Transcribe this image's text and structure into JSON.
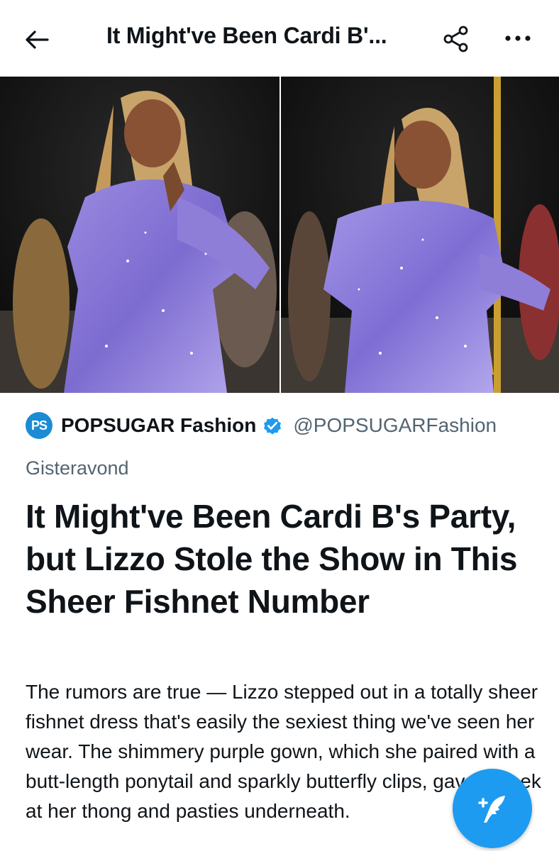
{
  "header": {
    "title": "It Might've Been Cardi B'...",
    "back_icon": "arrow-left-icon",
    "share_icon": "share-icon",
    "more_icon": "more-horizontal-icon"
  },
  "media": {
    "description_icons": [
      "photo-left",
      "photo-right"
    ]
  },
  "source": {
    "logo_text": "PS",
    "name": "POPSUGAR Fashion",
    "handle": "@POPSUGARFashion",
    "verified_icon": "verified-badge-icon"
  },
  "article": {
    "time": "Gisteravond",
    "headline": "It Might've Been Cardi B's Party, but Lizzo Stole the Show in This Sheer Fishnet Number",
    "body": "The rumors are true — Lizzo stepped out in a totally sheer fishnet dress that's easily the sexiest thing we've seen her wear. The shimmery purple gown, which she paired with a butt-length ponytail and sparkly butterfly clips, gave a peek at her thong and pasties underneath."
  },
  "fab": {
    "icon": "compose-tweet-icon"
  },
  "colors": {
    "accent": "#1d9bf0",
    "muted_text": "#536471",
    "text": "#0f1419",
    "dress": "#8b78d6"
  }
}
